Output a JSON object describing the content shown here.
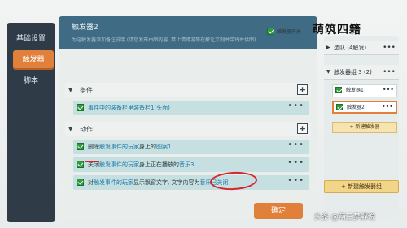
{
  "nav": {
    "items": [
      {
        "label": "基础设置"
      },
      {
        "label": "触发器"
      },
      {
        "label": "脚本"
      }
    ]
  },
  "main": {
    "title": "触发器2",
    "hint": "为这触发器添加备注说明 (请您发布由图内容, 禁止情缘游等在解让文制并带钱并供图)",
    "enable_label": "触发器开关",
    "conditions": {
      "title": "条件",
      "rows": [
        {
          "text": "事件中的装备栏里装备栏1(头面)"
        }
      ]
    },
    "actions": {
      "title": "动作",
      "rows": [
        {
          "prefix": "删除",
          "hl1": "触发事件的玩家",
          "mid": "身上的",
          "hl2": "图案1"
        },
        {
          "prefix": "关闭",
          "hl1": "触发事件的玩家",
          "mid": "身上正在播放的",
          "hl2": "音乐3"
        },
        {
          "prefix": "对",
          "hl1": "触发事件的玩家",
          "mid": "显示飘窗文字, 文字内容为",
          "hl2": "音乐已关闭"
        }
      ]
    },
    "more_glyph": "•••",
    "plus_glyph": "+",
    "confirm_label": "确定"
  },
  "right": {
    "group_collapsed": "选队 (4触发)",
    "group_open": "触发器组 3 (2)",
    "items": [
      {
        "label": "触发器1"
      },
      {
        "label": "触发器2"
      }
    ],
    "new_trigger_label": "+ 新建触发器",
    "new_group_label": "+ 新建触发器组"
  },
  "watermarks": {
    "top": "萌筑四籍",
    "bottom": "头条 @萌三梦解说"
  },
  "colors": {
    "accent": "#e0803a",
    "header": "#3f6b84",
    "row": "#c6dfe0",
    "nav": "#2f3c48"
  }
}
